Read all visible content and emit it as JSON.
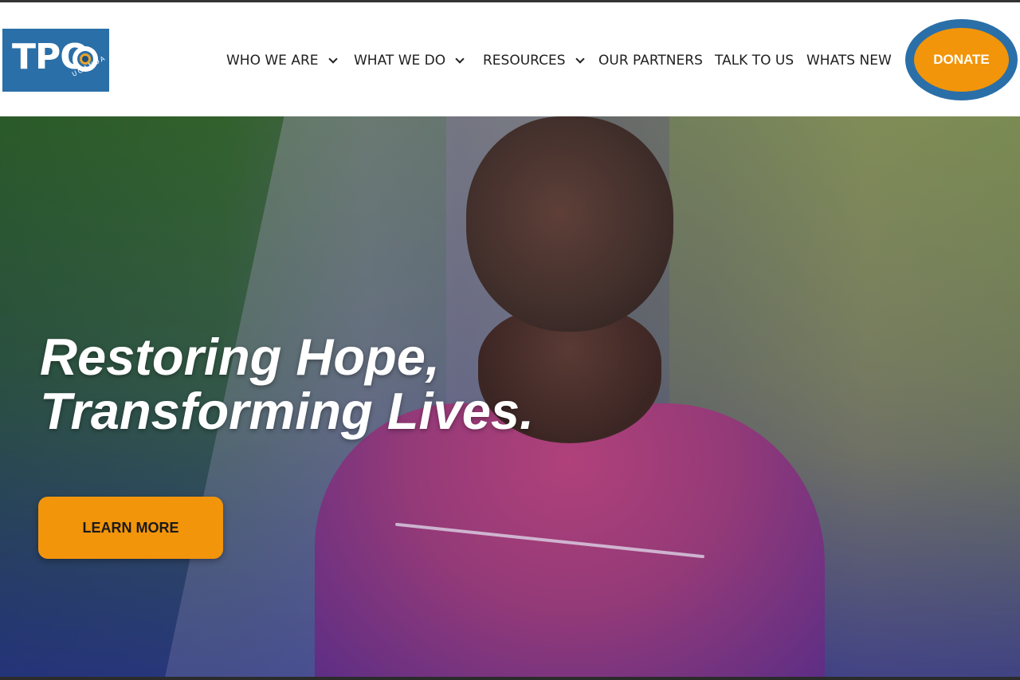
{
  "header": {
    "logo": {
      "text": "TPO",
      "subtext": "UGANDA"
    },
    "menu": [
      {
        "label": "WHO WE ARE",
        "has_dropdown": true
      },
      {
        "label": "WHAT WE DO",
        "has_dropdown": true
      },
      {
        "label": "RESOURCES",
        "has_dropdown": true
      },
      {
        "label": "OUR PARTNERS",
        "has_dropdown": false
      },
      {
        "label": "TALK TO US",
        "has_dropdown": false
      },
      {
        "label": "WHATS NEW",
        "has_dropdown": false
      }
    ],
    "donate_label": "DONATE"
  },
  "hero": {
    "title_line1": "Restoring Hope,",
    "title_line2": "Transforming Lives.",
    "cta_label": "LEARN MORE"
  },
  "colors": {
    "brand_blue": "#2a6fa8",
    "accent_orange": "#f2950a"
  }
}
